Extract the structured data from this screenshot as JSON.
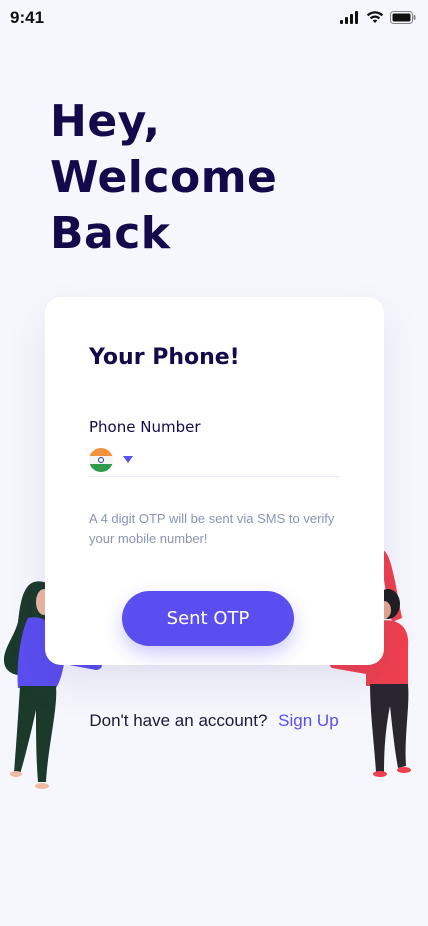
{
  "status_bar": {
    "time": "9:41",
    "icons": [
      "signal-icon",
      "wifi-icon",
      "battery-icon"
    ]
  },
  "header": {
    "line1": "Hey,",
    "line2": "Welcome",
    "line3": "Back"
  },
  "card": {
    "title": "Your Phone!",
    "field_label": "Phone Number",
    "country_flag": "india-flag-icon",
    "phone_value": "",
    "phone_placeholder": "",
    "hint": "A 4 digit OTP will be sent via SMS to verify your mobile number!",
    "button_label": "Sent OTP"
  },
  "footer": {
    "prompt": "Don't have an account?",
    "link": "Sign Up"
  },
  "colors": {
    "background": "#f6f7fd",
    "heading": "#14094a",
    "accent": "#5b4ef0",
    "hint": "#8a94b4",
    "woman_shirt": "#5b4ef0",
    "man_shirt": "#f0404f"
  }
}
